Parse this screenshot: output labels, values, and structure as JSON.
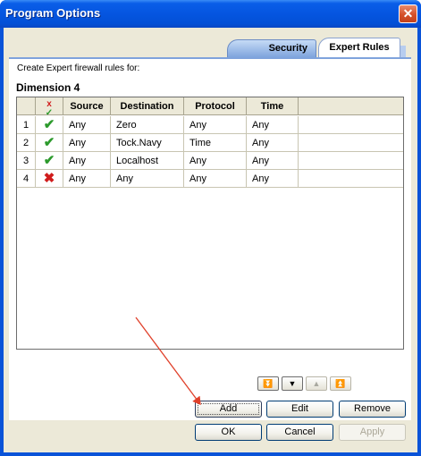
{
  "window": {
    "title": "Program Options",
    "close_glyph": "✕"
  },
  "tabs": [
    {
      "label": "Security",
      "active": false
    },
    {
      "label": "Expert Rules",
      "active": true
    }
  ],
  "caption": "Create Expert firewall rules for:",
  "group_title": "Dimension 4",
  "grid": {
    "columns": [
      "",
      "",
      "Source",
      "Destination",
      "Protocol",
      "Time"
    ],
    "rows": [
      {
        "num": "1",
        "status": "allow",
        "source": "Any",
        "destination": "Zero",
        "protocol": "Any",
        "time": "Any"
      },
      {
        "num": "2",
        "status": "allow",
        "source": "Any",
        "destination": "Tock.Navy",
        "protocol": "Time",
        "time": "Any"
      },
      {
        "num": "3",
        "status": "allow",
        "source": "Any",
        "destination": "Localhost",
        "protocol": "Any",
        "time": "Any"
      },
      {
        "num": "4",
        "status": "block",
        "source": "Any",
        "destination": "Any",
        "protocol": "Any",
        "time": "Any"
      }
    ],
    "status_icons": {
      "allow": "✔",
      "block": "✖"
    },
    "status_colors": {
      "allow": "#2c9a2c",
      "block": "#d01c1c"
    }
  },
  "move_buttons": [
    {
      "icon": "move-bottom-icon",
      "glyph": "⏬",
      "enabled": true
    },
    {
      "icon": "move-down-icon",
      "glyph": "▼",
      "enabled": true
    },
    {
      "icon": "move-up-icon",
      "glyph": "▲",
      "enabled": false
    },
    {
      "icon": "move-top-icon",
      "glyph": "⏫",
      "enabled": false
    }
  ],
  "buttons": {
    "add": "Add",
    "edit": "Edit",
    "remove": "Remove",
    "ok": "OK",
    "cancel": "Cancel",
    "apply": "Apply"
  },
  "colors": {
    "title_bar": "#0555e0",
    "dialog_face": "#ece9d8",
    "annotation_arrow": "#e0402a"
  }
}
